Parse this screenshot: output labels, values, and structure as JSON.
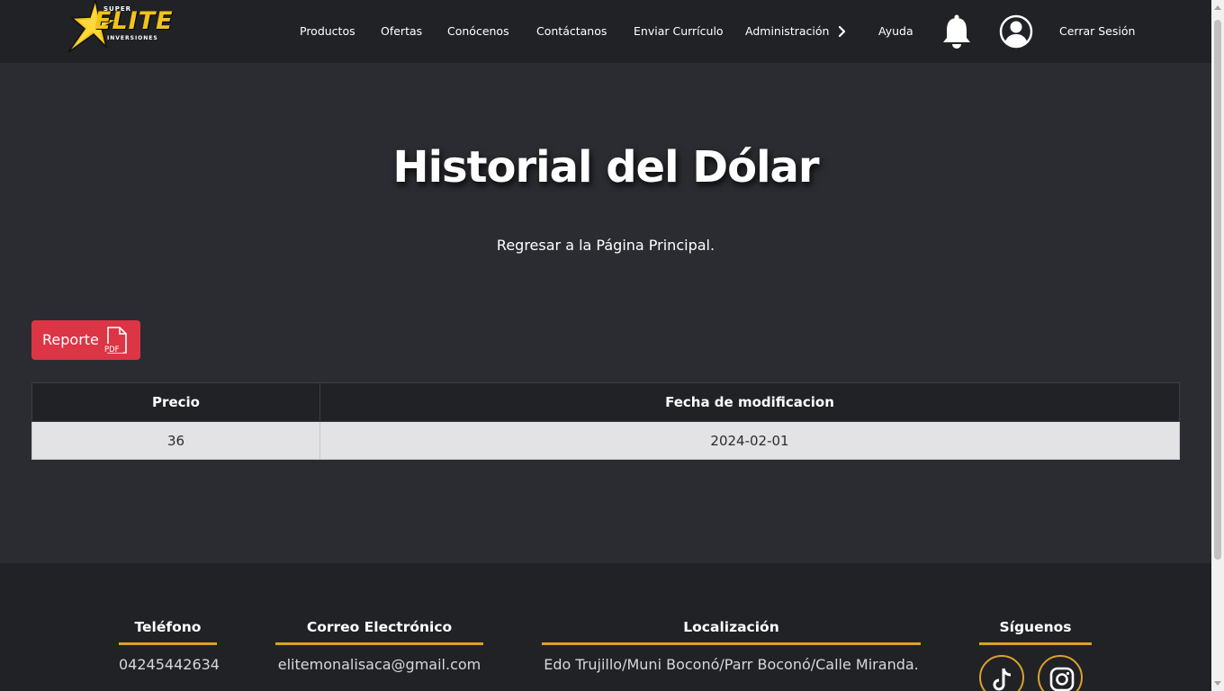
{
  "header": {
    "logo": {
      "super": "SUPER",
      "elite": "ELITE",
      "inversiones": "INVERSIONES"
    },
    "nav": [
      {
        "label": "Productos"
      },
      {
        "label": "Ofertas"
      },
      {
        "label": "Conócenos"
      },
      {
        "label": "Contáctanos"
      },
      {
        "label": "Enviar Currículo"
      },
      {
        "label": "Administración"
      },
      {
        "label": "Ayuda"
      }
    ],
    "logout": "Cerrar Sesión",
    "icons": [
      "chevron-right-icon",
      "bell-icon",
      "user-icon"
    ]
  },
  "main": {
    "title": "Historial del Dólar",
    "back_link": "Regresar a la Página Principal.",
    "report_button": {
      "label": "Reporte",
      "icon": "pdf-icon",
      "icon_text": "PDF",
      "color": "#dc3545"
    },
    "table": {
      "columns": [
        "Precio",
        "Fecha de modificacion"
      ],
      "rows": [
        [
          "36",
          "2024-02-01"
        ]
      ]
    }
  },
  "footer": {
    "phone": {
      "heading": "Teléfono",
      "value": "04245442634"
    },
    "email": {
      "heading": "Correo Electrónico",
      "value": "elitemonalisaca@gmail.com"
    },
    "location": {
      "heading": "Localización",
      "value": "Edo Trujillo/Muni Boconó/Parr Boconó/Calle Miranda."
    },
    "social": {
      "heading": "Síguenos",
      "icons": [
        "tiktok-icon",
        "instagram-icon"
      ]
    },
    "accent_color": "#d9a22e"
  },
  "colors": {
    "background": "#2b2c31",
    "header": "#212226",
    "logo_yellow": "#f2c31b"
  }
}
